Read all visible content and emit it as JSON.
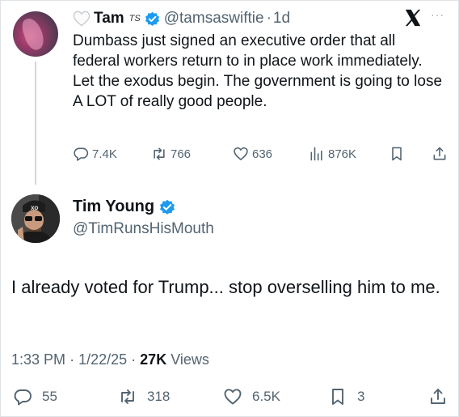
{
  "parent_tweet": {
    "display_name": "Tam",
    "name_suffix": "TS",
    "handle": "@tamsaswiftie",
    "separator": "·",
    "age": "1d",
    "text": "Dumbass just signed an executive order that all federal workers return to in place work immediately. Let the exodus begin. The government is going to lose A LOT of really good people.",
    "replies": "7.4K",
    "reposts": "766",
    "likes": "636",
    "views": "876K",
    "more_label": "···"
  },
  "main_tweet": {
    "display_name": "Tim Young",
    "handle": "@TimRunsHisMouth",
    "text": "I already voted for Trump... stop overselling him to me.",
    "time": "1:33 PM",
    "dot1": "·",
    "date": "1/22/25",
    "dot2": "·",
    "views_count": "27K",
    "views_label": "Views",
    "replies": "55",
    "reposts": "318",
    "likes": "6.5K",
    "bookmarks": "3"
  },
  "colors": {
    "text": "#0f1419",
    "secondary": "#536471",
    "verified": "#1d9bf0",
    "thread_line": "#cfd9de"
  },
  "icons": [
    "heart-outline-icon",
    "verified-badge-icon",
    "x-logo-icon",
    "reply-icon",
    "repost-icon",
    "like-icon",
    "views-icon",
    "bookmark-icon",
    "share-icon"
  ]
}
